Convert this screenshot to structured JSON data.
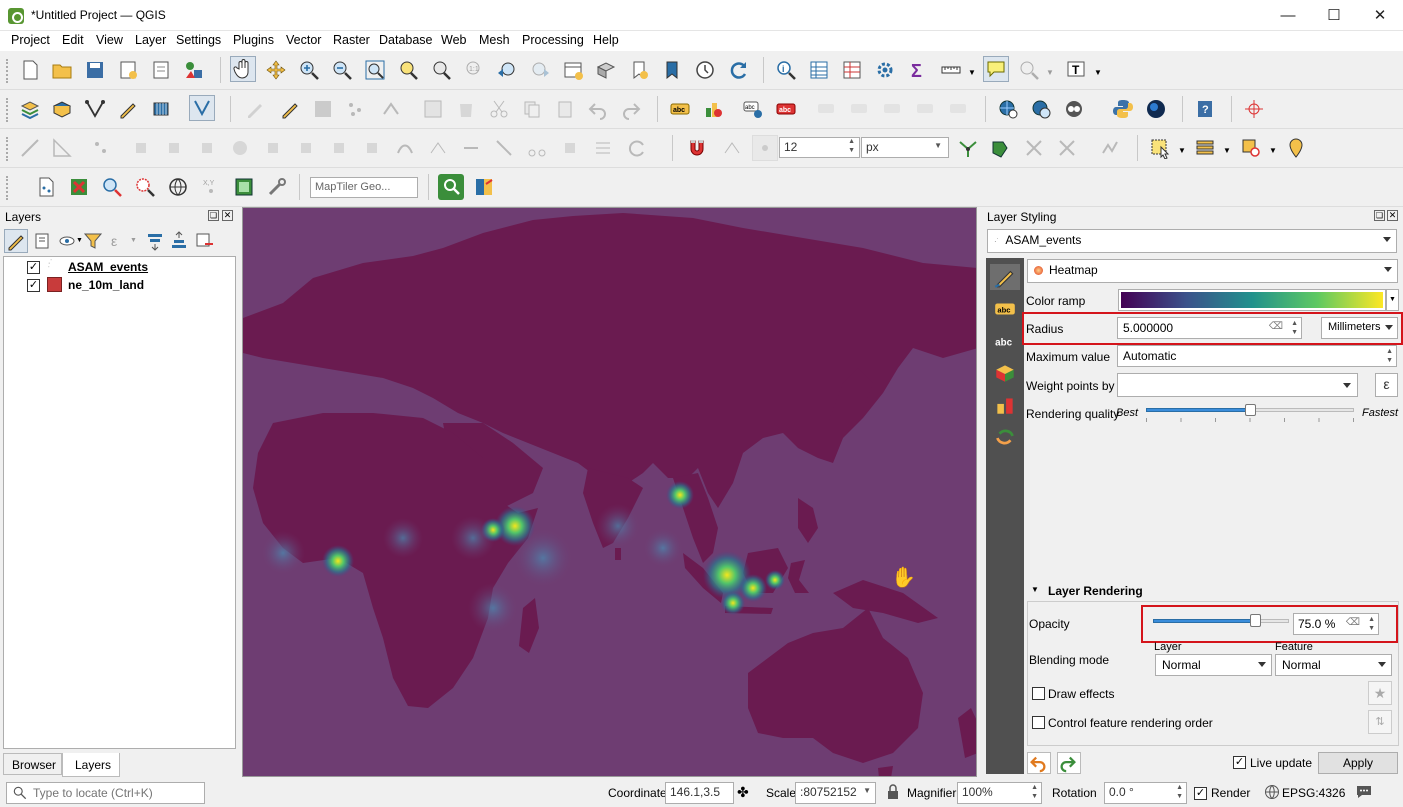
{
  "window": {
    "title": "*Untitled Project — QGIS"
  },
  "menu": [
    "Project",
    "Edit",
    "View",
    "Layer",
    "Settings",
    "Plugins",
    "Vector",
    "Raster",
    "Database",
    "Web",
    "Mesh",
    "Processing",
    "Help"
  ],
  "toolbar": {
    "snap_tolerance": "12",
    "snap_units": "px",
    "maptiler_placeholder": "MapTiler Geo..."
  },
  "layers_panel": {
    "title": "Layers",
    "items": [
      {
        "name": "ASAM_events",
        "checked": true,
        "icon": "point-layer-icon"
      },
      {
        "name": "ne_10m_land",
        "checked": true,
        "icon": "polygon-layer-icon",
        "color": "#c83b3b"
      }
    ],
    "tabs": [
      "Browser",
      "Layers"
    ],
    "active_tab": "Layers"
  },
  "styling": {
    "title": "Layer Styling",
    "layer": "ASAM_events",
    "renderer": "Heatmap",
    "color_ramp_label": "Color ramp",
    "radius_label": "Radius",
    "radius_value": "5.000000",
    "radius_unit": "Millimeters",
    "max_label": "Maximum value",
    "max_value": "Automatic",
    "weight_label": "Weight points by",
    "quality_label": "Rendering quality",
    "quality_best": "Best",
    "quality_fastest": "Fastest",
    "quality_level": 0.5,
    "rendering_title": "Layer Rendering",
    "opacity_label": "Opacity",
    "opacity_value": "75.0 %",
    "opacity_level": 0.75,
    "blending_label": "Blending mode",
    "blend_layer_label": "Layer",
    "blend_layer": "Normal",
    "blend_feature_label": "Feature",
    "blend_feature": "Normal",
    "draw_effects": "Draw effects",
    "control_order": "Control feature rendering order",
    "live_update": "Live update",
    "apply": "Apply"
  },
  "status": {
    "locate_placeholder": "Type to locate (Ctrl+K)",
    "coordinate_label": "Coordinate",
    "coordinate": "146.1,3.5",
    "scale_label": "Scale",
    "scale": ":80752152",
    "magnifier_label": "Magnifier",
    "magnifier": "100%",
    "rotation_label": "Rotation",
    "rotation": "0.0 °",
    "render_label": "Render",
    "crs": "EPSG:4326"
  },
  "colors": {
    "map_bg": "#6e3d72",
    "land": "#6a1b50",
    "accent": "#d4141b"
  }
}
